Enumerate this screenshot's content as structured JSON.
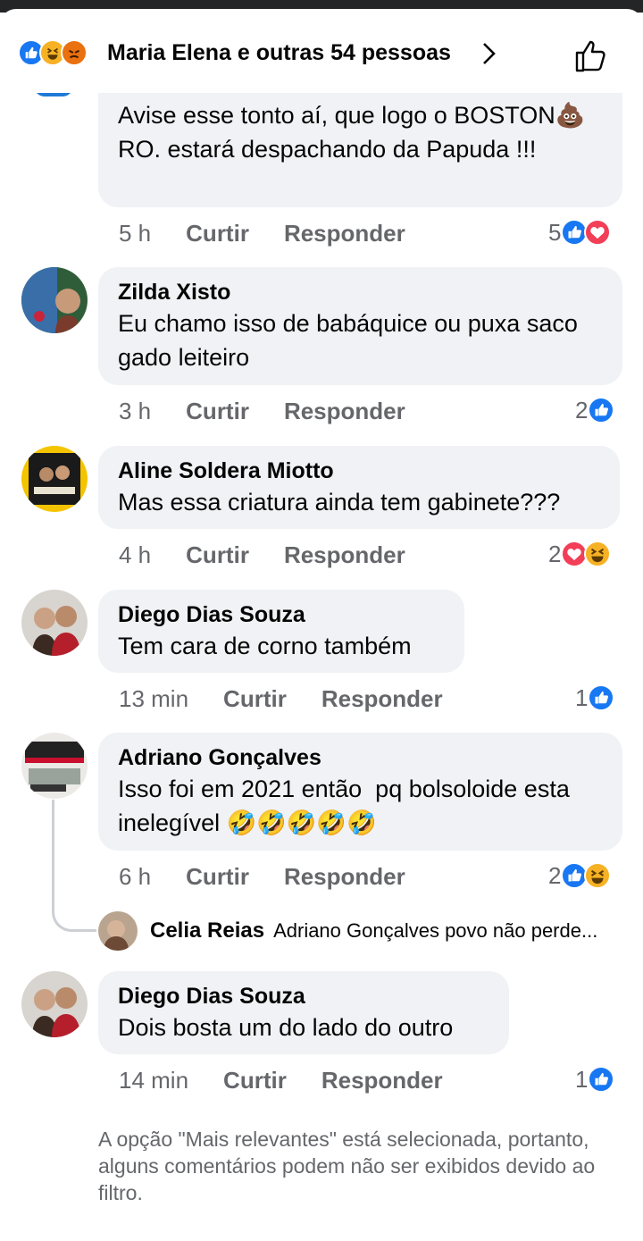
{
  "header": {
    "reactions": [
      "like-icon",
      "haha-icon",
      "angry-icon"
    ],
    "title": "Maria Elena e outras 54 pessoas"
  },
  "comments": [
    {
      "name": "",
      "text": "Avise esse tonto aí, que logo o BOSTON💩RO. estará despachando da Papuda !!!",
      "time": "5 h",
      "like": "Curtir",
      "reply": "Responder",
      "reaction_count": "5",
      "reactions": [
        "like-icon",
        "love-icon"
      ]
    },
    {
      "name": "Zilda Xisto",
      "text": "Eu chamo isso de babáquice ou puxa saco gado leiteiro",
      "time": "3 h",
      "like": "Curtir",
      "reply": "Responder",
      "reaction_count": "2",
      "reactions": [
        "like-icon"
      ]
    },
    {
      "name": "Aline Soldera Miotto",
      "text": "Mas essa criatura ainda tem gabinete???",
      "time": "4 h",
      "like": "Curtir",
      "reply": "Responder",
      "reaction_count": "2",
      "reactions": [
        "love-icon",
        "haha-icon"
      ]
    },
    {
      "name": "Diego Dias Souza",
      "text": "Tem cara de corno também",
      "time": "13 min",
      "like": "Curtir",
      "reply": "Responder",
      "reaction_count": "1",
      "reactions": [
        "like-icon"
      ]
    },
    {
      "name": "Adriano Gonçalves",
      "text": "Isso foi em 2021 então  pq bolsoloide esta inelegível 🤣🤣🤣🤣🤣",
      "time": "6 h",
      "like": "Curtir",
      "reply": "Responder",
      "reaction_count": "2",
      "reactions": [
        "like-icon",
        "haha-icon"
      ]
    },
    {
      "name": "Diego Dias Souza",
      "text": "Dois bosta um do lado do outro",
      "time": "14 min",
      "like": "Curtir",
      "reply": "Responder",
      "reaction_count": "1",
      "reactions": [
        "like-icon"
      ]
    }
  ],
  "reply_preview": {
    "name": "Celia Reias",
    "text": "Adriano Gonçalves povo não perde..."
  },
  "footer": {
    "note": "A opção \"Mais relevantes\" está selecionada, portanto, alguns comentários podem não ser exibidos devido ao filtro."
  },
  "colors": {
    "like": "#1877f2",
    "love": "#f33e58",
    "haha": "#f7b125",
    "bubble": "#f0f2f5",
    "meta": "#65676b"
  }
}
